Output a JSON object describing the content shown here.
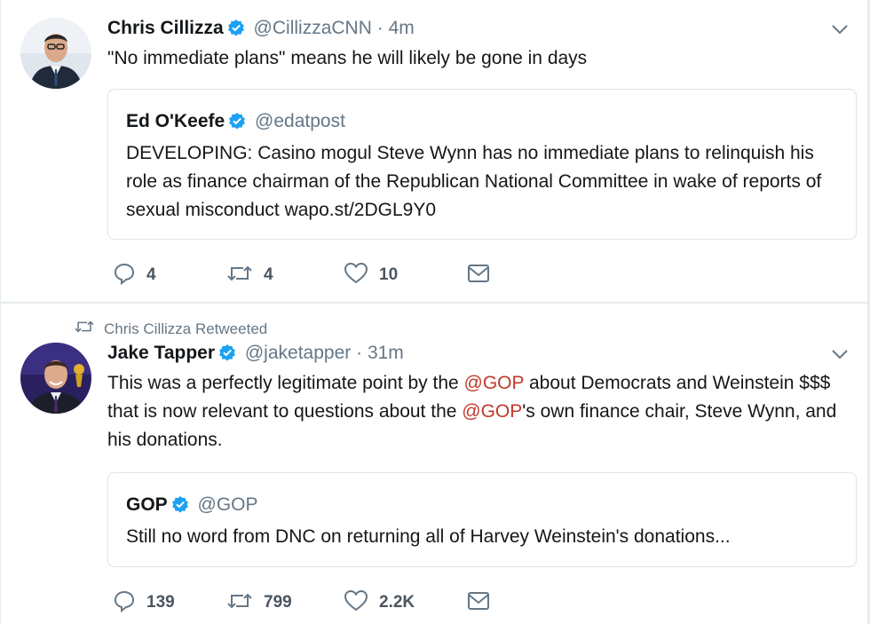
{
  "colors": {
    "accent_blue": "#1da1f2",
    "mention": "#c0392b",
    "muted": "#657786",
    "border": "#e6ecf0"
  },
  "tweets": [
    {
      "author_name": "Chris Cillizza",
      "author_handle": "@CillizzaCNN",
      "separator": "·",
      "time": "4m",
      "text": "\"No immediate plans\" means he will likely be gone in days",
      "avatar_icon": "avatar-photo",
      "quote": {
        "author_name": "Ed O'Keefe",
        "author_handle": "@edatpost",
        "text": "DEVELOPING: Casino mogul Steve Wynn has no immediate plans to relinquish his role as finance chairman of the Republican National Committee in wake of reports of sexual misconduct wapo.st/2DGL9Y0"
      },
      "counts": {
        "replies": "4",
        "retweets": "4",
        "likes": "10"
      }
    },
    {
      "retweeted_by": "Chris Cillizza Retweeted",
      "author_name": "Jake Tapper",
      "author_handle": "@jaketapper",
      "separator": "·",
      "time": "31m",
      "text_parts": {
        "p1": "This was a perfectly legitimate point by the ",
        "m1": "@GOP",
        "p2": " about Democrats and Weinstein $$$ that is now relevant to questions about the ",
        "m2": "@GOP",
        "p3": "'s own finance chair, Steve Wynn, and his donations."
      },
      "avatar_icon": "avatar-photo",
      "quote": {
        "author_name": "GOP",
        "author_handle": "@GOP",
        "text": "Still no word from DNC on returning all of Harvey Weinstein's donations..."
      },
      "counts": {
        "replies": "139",
        "retweets": "799",
        "likes": "2.2K"
      }
    }
  ],
  "icons": {
    "reply": "reply-icon",
    "retweet": "retweet-icon",
    "like": "heart-icon",
    "dm": "envelope-icon",
    "verified": "verified-badge-icon",
    "caret": "chevron-down-icon"
  }
}
